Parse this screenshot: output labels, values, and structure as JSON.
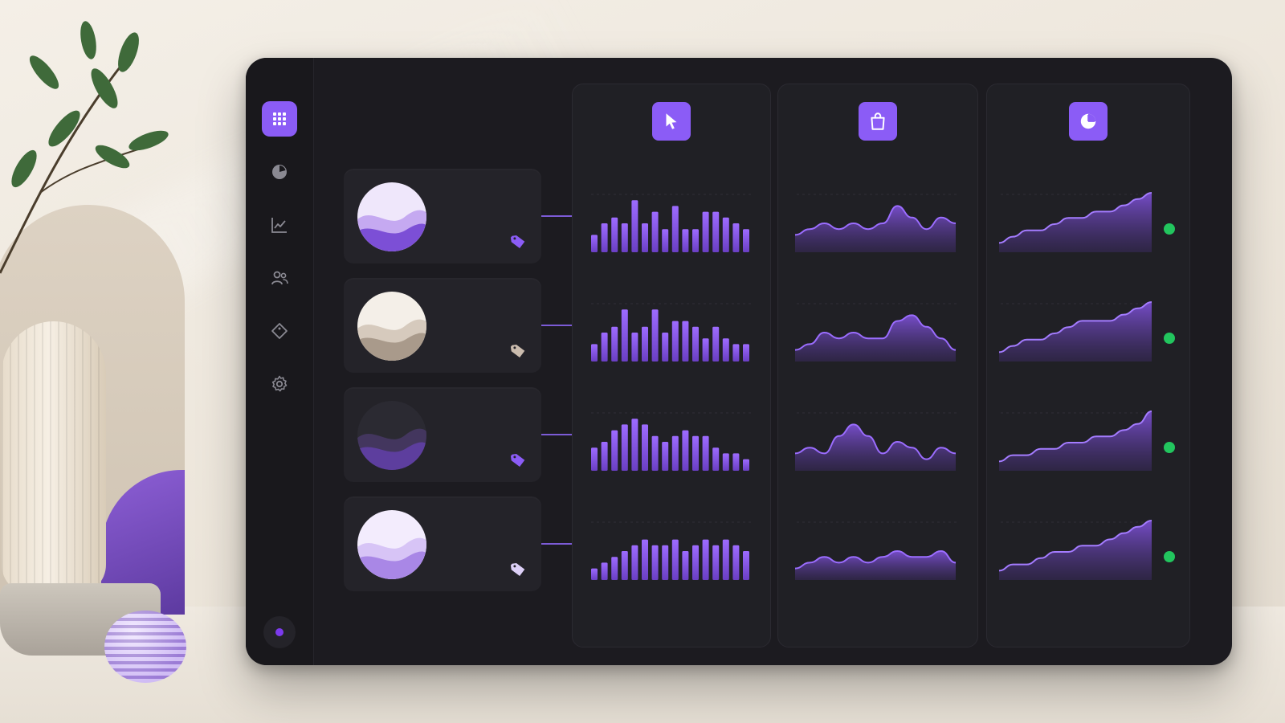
{
  "colors": {
    "accent": "#8b5cf6",
    "accent_dark": "#5b3ea3",
    "panel": "#1c1b20",
    "status_green": "#22c55e"
  },
  "sidebar": {
    "items": [
      {
        "icon": "grid-icon",
        "active": true
      },
      {
        "icon": "pie-chart-icon",
        "active": false
      },
      {
        "icon": "line-chart-icon",
        "active": false
      },
      {
        "icon": "users-icon",
        "active": false
      },
      {
        "icon": "tag-icon",
        "active": false
      },
      {
        "icon": "gear-icon",
        "active": false
      }
    ],
    "status_dot_color": "#7c3aed"
  },
  "columns": [
    {
      "icon": "cursor-icon",
      "kind": "bars"
    },
    {
      "icon": "shopping-bag-icon",
      "kind": "wave"
    },
    {
      "icon": "pie-chart-icon",
      "kind": "area"
    }
  ],
  "products": [
    {
      "thumb": "purple",
      "tag_color": "#8b5cf6",
      "bars": [
        3,
        5,
        6,
        5,
        9,
        5,
        7,
        4,
        8,
        4,
        4,
        7,
        7,
        6,
        5,
        4
      ],
      "wave": [
        3,
        4,
        5,
        4,
        5,
        4,
        5,
        8,
        6,
        4,
        6,
        5
      ],
      "area": [
        2,
        3,
        4,
        4,
        5,
        6,
        6,
        7,
        7,
        8,
        9,
        10
      ]
    },
    {
      "thumb": "beige",
      "tag_color": "#cbbcae",
      "bars": [
        3,
        5,
        6,
        9,
        5,
        6,
        9,
        5,
        7,
        7,
        6,
        4,
        6,
        4,
        3,
        3
      ],
      "wave": [
        2,
        3,
        5,
        4,
        5,
        4,
        4,
        7,
        8,
        6,
        4,
        2
      ],
      "area": [
        2,
        3,
        4,
        4,
        5,
        6,
        7,
        7,
        7,
        8,
        9,
        10
      ]
    },
    {
      "thumb": "dark",
      "tag_color": "#8b5cf6",
      "bars": [
        4,
        5,
        7,
        8,
        9,
        8,
        6,
        5,
        6,
        7,
        6,
        6,
        4,
        3,
        3,
        2
      ],
      "wave": [
        3,
        4,
        3,
        6,
        8,
        6,
        3,
        5,
        4,
        2,
        4,
        3
      ],
      "area": [
        2,
        3,
        3,
        4,
        4,
        5,
        5,
        6,
        6,
        7,
        8,
        10
      ]
    },
    {
      "thumb": "light-purple",
      "tag_color": "#ddd0f7",
      "bars": [
        2,
        3,
        4,
        5,
        6,
        7,
        6,
        6,
        7,
        5,
        6,
        7,
        6,
        7,
        6,
        5
      ],
      "wave": [
        2,
        3,
        4,
        3,
        4,
        3,
        4,
        5,
        4,
        4,
        5,
        3
      ],
      "area": [
        2,
        3,
        3,
        4,
        5,
        5,
        6,
        6,
        7,
        8,
        9,
        10
      ]
    }
  ],
  "status_indicators": [
    true,
    true,
    true,
    true
  ]
}
